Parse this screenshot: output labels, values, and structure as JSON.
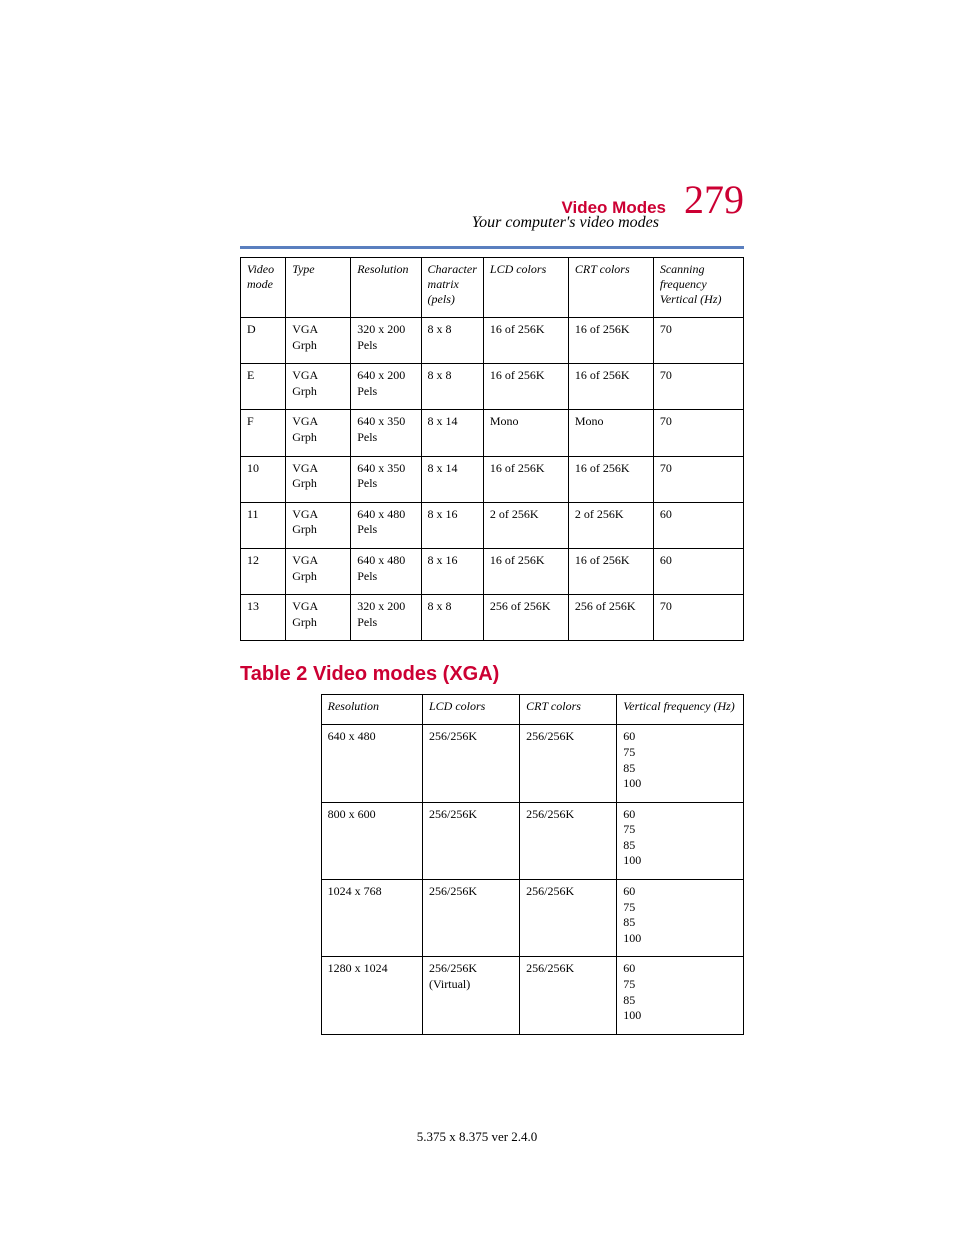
{
  "header": {
    "title": "Video Modes",
    "page_number": "279",
    "subtitle": "Your computer's video modes"
  },
  "table1": {
    "headers": [
      "Video mode",
      "Type",
      "Resolution",
      "Character matrix (pels)",
      "LCD colors",
      "CRT colors",
      "Scanning frequency Vertical (Hz)"
    ],
    "rows": [
      [
        "D",
        "VGA Grph",
        "320 x 200 Pels",
        "8 x 8",
        "16 of 256K",
        "16 of 256K",
        "70"
      ],
      [
        "E",
        "VGA Grph",
        "640 x 200 Pels",
        "8 x 8",
        "16 of 256K",
        "16 of 256K",
        "70"
      ],
      [
        "F",
        "VGA Grph",
        "640 x 350 Pels",
        "8 x 14",
        "Mono",
        "Mono",
        "70"
      ],
      [
        "10",
        "VGA Grph",
        "640 x 350 Pels",
        "8 x 14",
        "16 of 256K",
        "16 of 256K",
        "70"
      ],
      [
        "11",
        "VGA Grph",
        "640 x 480 Pels",
        "8 x 16",
        "2 of 256K",
        "2 of 256K",
        "60"
      ],
      [
        "12",
        "VGA Grph",
        "640 x 480 Pels",
        "8 x 16",
        "16 of 256K",
        "16 of 256K",
        "60"
      ],
      [
        "13",
        "VGA Grph",
        "320 x 200 Pels",
        "8 x 8",
        "256 of 256K",
        "256 of 256K",
        "70"
      ]
    ]
  },
  "section_title": "Table 2 Video modes (XGA)",
  "table2": {
    "headers": [
      "Resolution",
      "LCD colors",
      "CRT colors",
      "Vertical frequency (Hz)"
    ],
    "rows": [
      [
        "640 x 480",
        "256/256K",
        "256/256K",
        "60\n75\n85\n100"
      ],
      [
        "800 x 600",
        "256/256K",
        "256/256K",
        "60\n75\n85\n100"
      ],
      [
        "1024 x 768",
        "256/256K",
        "256/256K",
        "60\n75\n85\n100"
      ],
      [
        "1280 x 1024",
        "256/256K (Virtual)",
        "256/256K",
        "60\n75\n85\n100"
      ]
    ]
  },
  "footer": "5.375 x 8.375 ver 2.4.0"
}
